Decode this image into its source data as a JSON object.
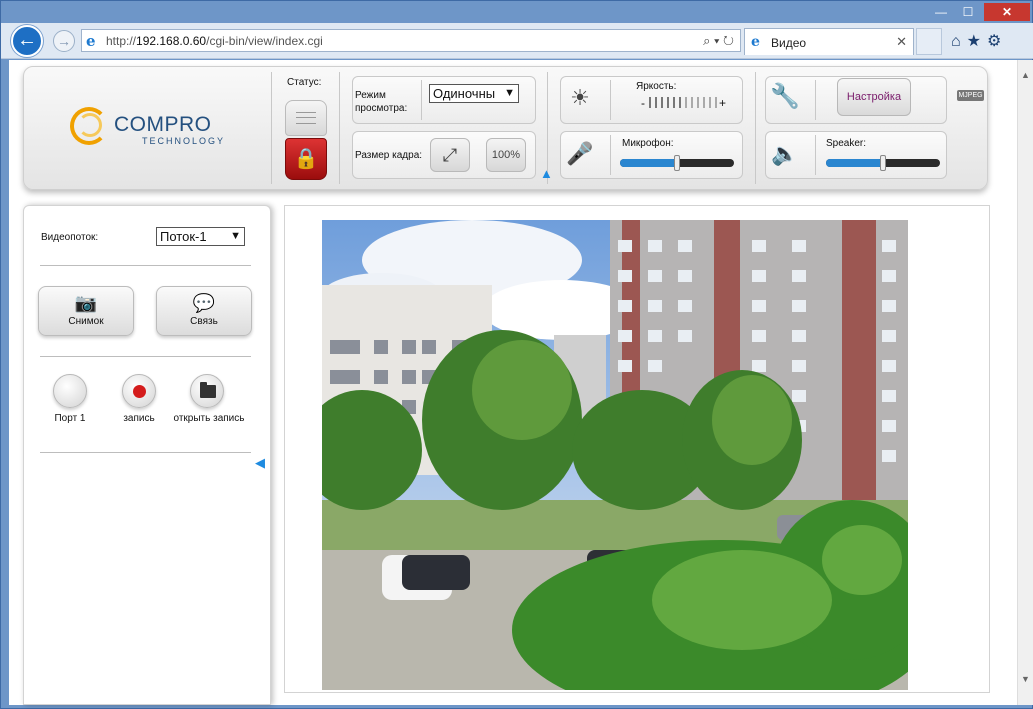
{
  "browser": {
    "url_prefix": "http://",
    "url_host": "192.168.0.60",
    "url_path": "/cgi-bin/view/index.cgi",
    "tab_title": "Видео",
    "window_buttons": {
      "min": "—",
      "max": "☐",
      "close": "✕"
    },
    "address_icons": "⌕ ▾ ↻",
    "tab_close": "✕",
    "tools": "⌂★⚙"
  },
  "brand": {
    "name": "COMPRO",
    "subtitle": "TECHNOLOGY"
  },
  "toolbar": {
    "status_label": "Статус:",
    "view_mode_label": "Режим просмотра:",
    "view_mode_value": "Одиночны",
    "frame_size_label": "Размер кадра:",
    "frame_100_label": "100%",
    "brightness_label": "Яркость:",
    "brightness_minus": "-",
    "brightness_plus": "+",
    "brightness_level": 0.5,
    "microphone_label": "Микрофон:",
    "microphone_level": 0.5,
    "setup_label": "Настройка",
    "speaker_label": "Speaker:",
    "speaker_level": 0.5,
    "format_badge": "MJPEG"
  },
  "leftpanel": {
    "stream_label": "Видеопоток:",
    "stream_value": "Поток-1",
    "snapshot_label": "Снимок",
    "talk_label": "Связь",
    "port_label": "Порт 1",
    "record_label": "запись",
    "open_record_label": "открыть запись"
  },
  "colors": {
    "accent": "#2a86d0",
    "lock_red": "#c81e1e",
    "setup_text": "#7a1b6b"
  }
}
